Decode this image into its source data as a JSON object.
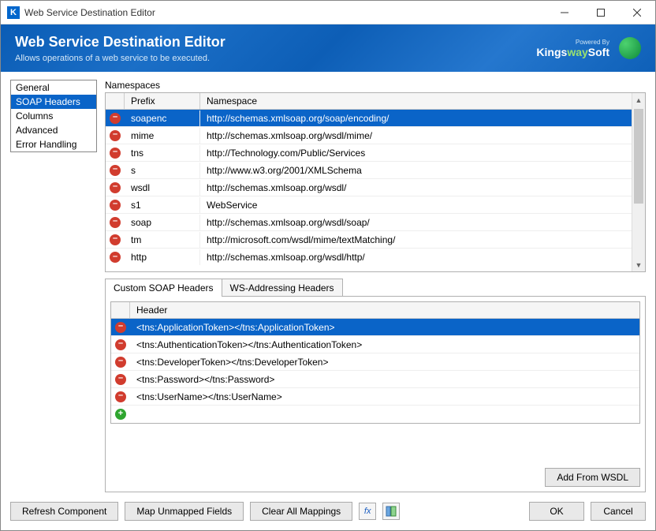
{
  "window": {
    "title": "Web Service Destination Editor",
    "icon_letter": "K"
  },
  "banner": {
    "heading": "Web Service Destination Editor",
    "subheading": "Allows operations of a web service to be executed.",
    "powered_by": "Powered By",
    "brand1": "Kings",
    "brand2": "way",
    "brand3": "Soft"
  },
  "nav": {
    "items": [
      {
        "label": "General",
        "selected": false
      },
      {
        "label": "SOAP Headers",
        "selected": true
      },
      {
        "label": "Columns",
        "selected": false
      },
      {
        "label": "Advanced",
        "selected": false
      },
      {
        "label": "Error Handling",
        "selected": false
      }
    ]
  },
  "namespaces": {
    "label": "Namespaces",
    "columns": {
      "prefix": "Prefix",
      "namespace": "Namespace"
    },
    "rows": [
      {
        "prefix": "soapenc",
        "ns": "http://schemas.xmlsoap.org/soap/encoding/",
        "selected": true
      },
      {
        "prefix": "mime",
        "ns": "http://schemas.xmlsoap.org/wsdl/mime/",
        "selected": false
      },
      {
        "prefix": "tns",
        "ns": "http://Technology.com/Public/Services",
        "selected": false
      },
      {
        "prefix": "s",
        "ns": "http://www.w3.org/2001/XMLSchema",
        "selected": false
      },
      {
        "prefix": "wsdl",
        "ns": "http://schemas.xmlsoap.org/wsdl/",
        "selected": false
      },
      {
        "prefix": "s1",
        "ns": "WebService",
        "selected": false
      },
      {
        "prefix": "soap",
        "ns": "http://schemas.xmlsoap.org/wsdl/soap/",
        "selected": false
      },
      {
        "prefix": "tm",
        "ns": "http://microsoft.com/wsdl/mime/textMatching/",
        "selected": false
      },
      {
        "prefix": "http",
        "ns": "http://schemas.xmlsoap.org/wsdl/http/",
        "selected": false
      }
    ]
  },
  "tabs": {
    "custom": "Custom SOAP Headers",
    "ws": "WS-Addressing Headers"
  },
  "headersGrid": {
    "column": "Header",
    "rows": [
      {
        "header": "<tns:ApplicationToken></tns:ApplicationToken>",
        "selected": true
      },
      {
        "header": "<tns:AuthenticationToken></tns:AuthenticationToken>",
        "selected": false
      },
      {
        "header": "<tns:DeveloperToken></tns:DeveloperToken>",
        "selected": false
      },
      {
        "header": "<tns:Password></tns:Password>",
        "selected": false
      },
      {
        "header": "<tns:UserName></tns:UserName>",
        "selected": false
      }
    ]
  },
  "buttons": {
    "addFromWsdl": "Add From WSDL",
    "refresh": "Refresh Component",
    "mapUnmapped": "Map Unmapped Fields",
    "clearMappings": "Clear All Mappings",
    "ok": "OK",
    "cancel": "Cancel",
    "fx": "fx"
  }
}
